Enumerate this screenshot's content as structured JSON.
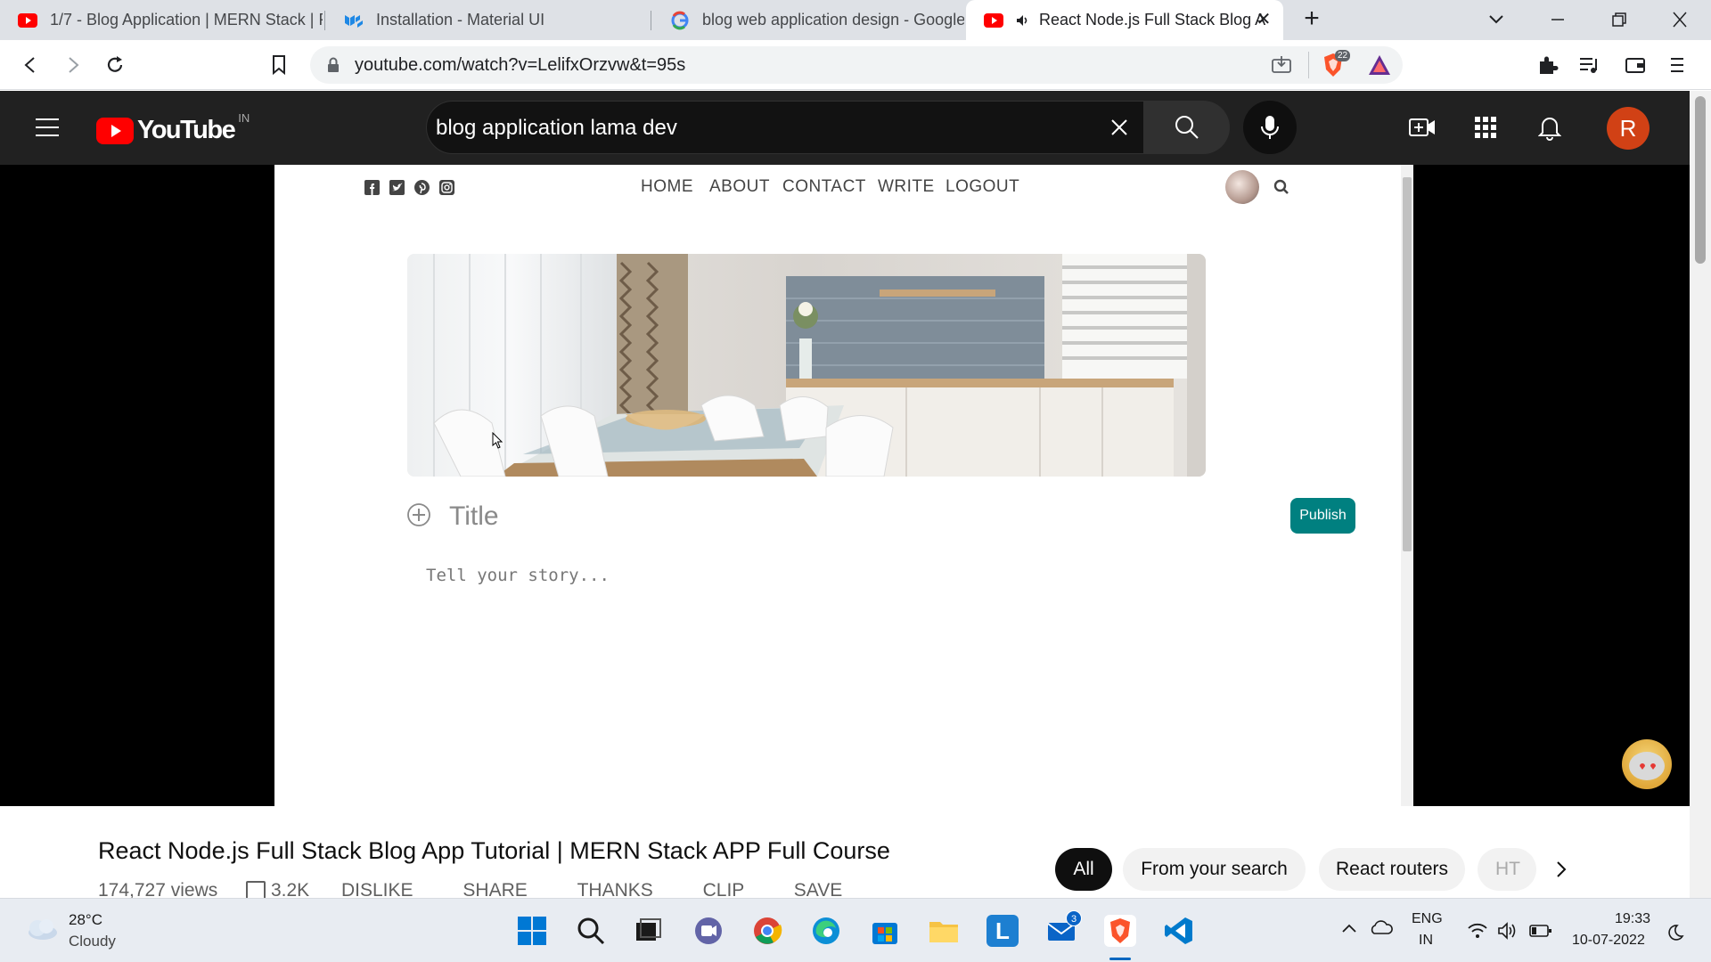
{
  "tabs": [
    {
      "title": "1/7 - Blog Application | MERN Stack | F"
    },
    {
      "title": "Installation - Material UI"
    },
    {
      "title": "blog web application design - Google"
    },
    {
      "title": "React Node.js Full Stack Blog A"
    }
  ],
  "address": {
    "url": "youtube.com/watch?v=LelifxOrzvw&t=95s",
    "brave_shield_count": "22"
  },
  "youtube": {
    "logo_text": "YouTube",
    "region": "IN",
    "search_value": "blog application lama dev",
    "avatar_letter": "R"
  },
  "blog": {
    "nav": [
      "HOME",
      "ABOUT",
      "CONTACT",
      "WRITE",
      "LOGOUT"
    ],
    "title_placeholder": "Title",
    "story_placeholder": "Tell your story...",
    "publish_label": "Publish"
  },
  "video": {
    "title": "React Node.js Full Stack Blog App Tutorial | MERN Stack APP Full Course",
    "views": "174,727 views",
    "likes": "3.2K",
    "actions": [
      "DISLIKE",
      "SHARE",
      "THANKS",
      "CLIP",
      "SAVE"
    ]
  },
  "chips": [
    "All",
    "From your search",
    "React routers",
    "HT"
  ],
  "taskbar": {
    "weather_temp": "28°C",
    "weather_desc": "Cloudy",
    "lang_top": "ENG",
    "lang_bottom": "IN",
    "time": "19:33",
    "date": "10-07-2022",
    "mail_badge": "3"
  }
}
